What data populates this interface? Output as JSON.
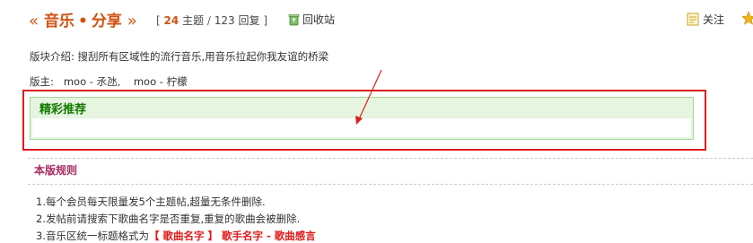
{
  "header": {
    "quote_left": "«",
    "forum_name_part1": "音乐",
    "dot": "•",
    "forum_name_part2": "分享",
    "quote_right": "»",
    "stats_bracket_open": "[",
    "topics_count": "24",
    "topics_label": "主题",
    "stats_sep": "/",
    "replies_count": "123",
    "replies_label": "回复",
    "stats_bracket_close": "]",
    "recycle_label": "回收站",
    "follow_label": "关注"
  },
  "intro": {
    "text": "版块介绍: 搜刮所有区域性的流行音乐,用音乐拉起你我友谊的桥梁"
  },
  "moderators": {
    "label": "版主:",
    "list": [
      "moo - 氶氹,",
      "moo - 柠檬"
    ]
  },
  "featured": {
    "title": "精彩推荐"
  },
  "rules": {
    "title": "本版规则",
    "line1": "1.每个会员每天限量发5个主题帖,超量无条件删除.",
    "line2": "2.发帖前请搜索下歌曲名字是否重复,重复的歌曲会被删除.",
    "line3_prefix": "3.音乐区统一标题格式为",
    "line3_red": "【 歌曲名字 】 歌手名字 - 歌曲感言"
  },
  "colors": {
    "title_orange": "#d15311",
    "featured_green": "#157a00",
    "highlight_red": "#e01c1c",
    "rules_title": "#a72a62"
  },
  "icons": [
    "recycle-bin-icon",
    "follow-icon",
    "star-icon",
    "annotation-arrow"
  ]
}
